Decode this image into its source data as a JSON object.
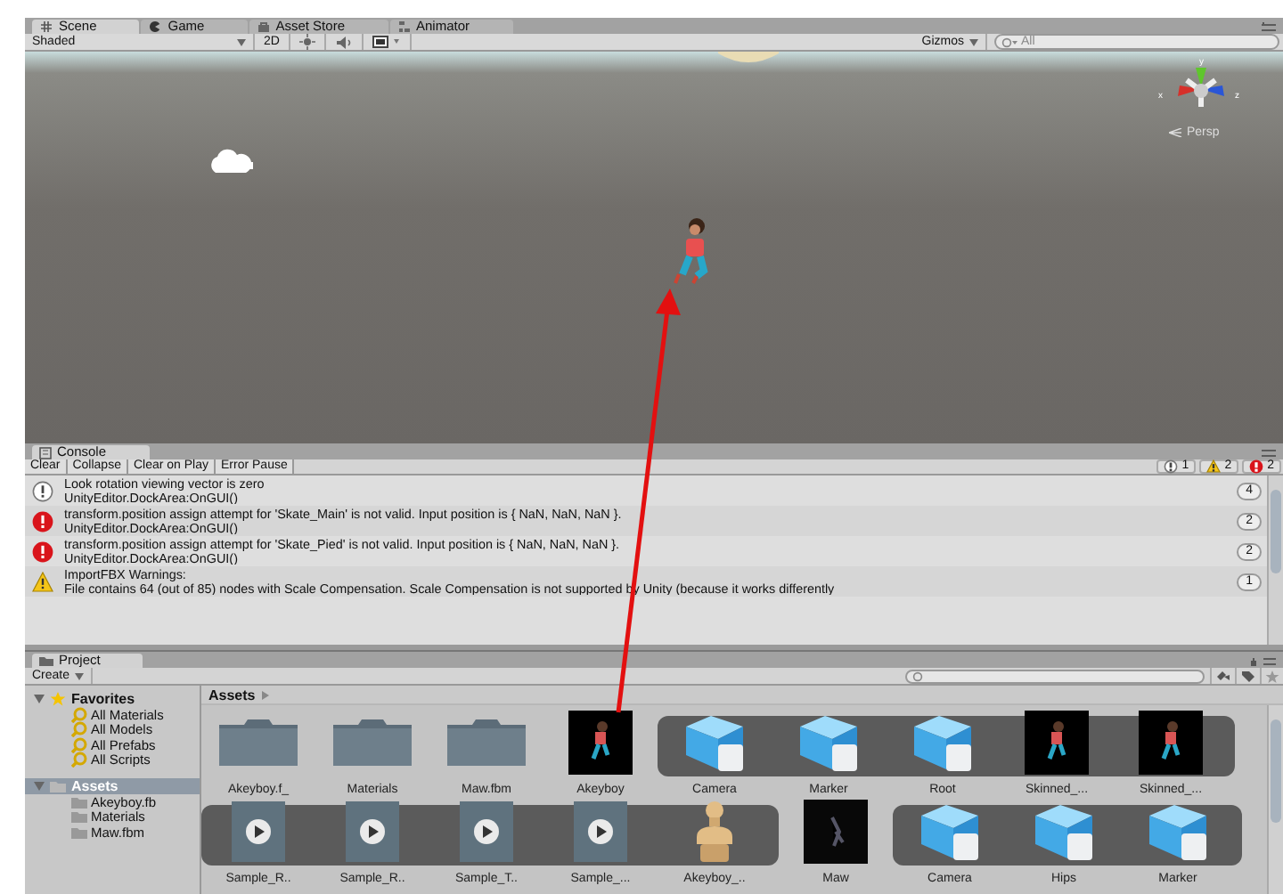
{
  "scene": {
    "tabs": [
      {
        "label": "Scene",
        "selected": true
      },
      {
        "label": "Game",
        "selected": false
      },
      {
        "label": "Asset Store",
        "selected": false
      },
      {
        "label": "Animator",
        "selected": false
      }
    ],
    "toolbar": {
      "shading": "Shaded",
      "mode": "2D",
      "gizmos": "Gizmos",
      "search_placeholder": "All"
    },
    "gizmo": {
      "y": "y",
      "x": "x",
      "z": "z",
      "projection": "Persp"
    }
  },
  "console": {
    "tab": "Console",
    "buttons": [
      "Clear",
      "Collapse",
      "Clear on Play",
      "Error Pause"
    ],
    "counts": [
      {
        "kind": "info",
        "count": "1"
      },
      {
        "kind": "warning",
        "count": "2"
      },
      {
        "kind": "error",
        "count": "2"
      }
    ],
    "entries": [
      {
        "kind": "info",
        "message": "Look rotation viewing vector is zero",
        "detail": "UnityEditor.DockArea:OnGUI()",
        "count": "4"
      },
      {
        "kind": "error",
        "message": "transform.position assign attempt for 'Skate_Main' is not valid. Input position is { NaN, NaN, NaN }.",
        "detail": "UnityEditor.DockArea:OnGUI()",
        "count": "2"
      },
      {
        "kind": "error",
        "message": "transform.position assign attempt for 'Skate_Pied' is not valid. Input position is { NaN, NaN, NaN }.",
        "detail": "UnityEditor.DockArea:OnGUI()",
        "count": "2"
      },
      {
        "kind": "warning",
        "message": "ImportFBX Warnings:",
        "detail": "File contains 64 (out of 85) nodes with Scale Compensation. Scale Compensation is not supported by Unity (because it works differently",
        "count": "1"
      }
    ]
  },
  "project": {
    "tab": "Project",
    "create": "Create",
    "tree": [
      {
        "label": "Favorites",
        "kind": "star",
        "expanded": true,
        "selected": false,
        "children": [
          {
            "label": "All Materials",
            "kind": "search"
          },
          {
            "label": "All Models",
            "kind": "search"
          },
          {
            "label": "All Prefabs",
            "kind": "search"
          },
          {
            "label": "All Scripts",
            "kind": "search"
          }
        ]
      },
      {
        "label": "Assets",
        "kind": "folder",
        "expanded": true,
        "selected": true,
        "children": [
          {
            "label": "Akeyboy.fb",
            "kind": "folder"
          },
          {
            "label": "Materials",
            "kind": "folder"
          },
          {
            "label": "Maw.fbm",
            "kind": "folder"
          }
        ]
      }
    ],
    "breadcrumb": "Assets",
    "rows": [
      [
        {
          "strip": false,
          "items": [
            {
              "kind": "folder",
              "label": "Akeyboy.f_"
            },
            {
              "kind": "folder",
              "label": "Materials"
            },
            {
              "kind": "folder",
              "label": "Maw.fbm"
            },
            {
              "kind": "model",
              "label": "Akeyboy"
            }
          ]
        },
        {
          "strip": true,
          "items": [
            {
              "kind": "prefab",
              "label": "Camera"
            },
            {
              "kind": "prefab",
              "label": "Marker"
            },
            {
              "kind": "prefab",
              "label": "Root"
            },
            {
              "kind": "model",
              "label": "Skinned_..."
            },
            {
              "kind": "model",
              "label": "Skinned_..."
            }
          ]
        }
      ],
      [
        {
          "strip": true,
          "items": [
            {
              "kind": "clip",
              "label": "Sample_R.."
            },
            {
              "kind": "clip",
              "label": "Sample_R.."
            },
            {
              "kind": "clip",
              "label": "Sample_T.."
            },
            {
              "kind": "clip",
              "label": "Sample_..."
            },
            {
              "kind": "avatar",
              "label": "Akeyboy_.."
            }
          ]
        },
        {
          "strip": false,
          "items": [
            {
              "kind": "dark-model",
              "label": "Maw"
            }
          ]
        },
        {
          "strip": true,
          "items": [
            {
              "kind": "prefab",
              "label": "Camera"
            },
            {
              "kind": "prefab",
              "label": "Hips"
            },
            {
              "kind": "prefab",
              "label": "Marker"
            }
          ]
        }
      ]
    ]
  }
}
